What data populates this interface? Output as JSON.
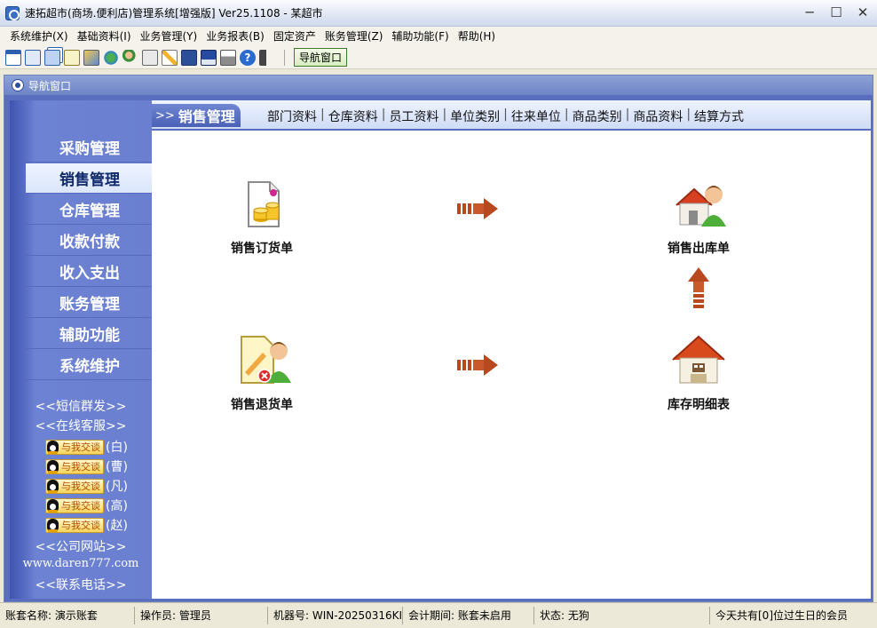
{
  "window": {
    "title": "速拓超市(商场.便利店)管理系统[增强版] Ver25.1108 - 某超市",
    "controls": [
      "─",
      "☐",
      "✕"
    ]
  },
  "menu": [
    "系统维护(X)",
    "基础资料(I)",
    "业务管理(Y)",
    "业务报表(B)",
    "固定资产",
    "账务管理(Z)",
    "辅助功能(F)",
    "帮助(H)"
  ],
  "toolbar": {
    "icons": [
      "grid-icon",
      "form-icon",
      "windows-icon",
      "message-icon",
      "report-icon",
      "refresh-icon",
      "users-icon",
      "print-preview-icon",
      "edit-icon",
      "calculator-icon",
      "save-icon",
      "printer-icon",
      "help-icon",
      "exit-icon"
    ],
    "nav_button": "导航窗口"
  },
  "nav_window": {
    "title": "导航窗口"
  },
  "sidebar": {
    "items": [
      "采购管理",
      "销售管理",
      "仓库管理",
      "收款付款",
      "收入支出",
      "账务管理",
      "辅助功能",
      "系统维护"
    ],
    "active_index": 1,
    "sms": "<<短信群发>>",
    "online_service": "<<在线客服>>",
    "qq_label": "与我交谈",
    "qq_contacts": [
      "(白)",
      "(曹)",
      "(凡)",
      "(高)",
      "(赵)"
    ],
    "company_site": "<<公司网站>>",
    "url": "www.daren777.com",
    "phone": "<<联系电话>>"
  },
  "content": {
    "prefix": ">>",
    "section": "销售管理",
    "links": [
      "部门资料",
      "仓库资料",
      "员工资料",
      "单位类别",
      "往来单位",
      "商品类别",
      "商品资料",
      "结算方式"
    ],
    "link_separator": "|",
    "flow": {
      "sales_order": "销售订货单",
      "sales_out": "销售出库单",
      "sales_return": "销售退货单",
      "inventory_detail": "库存明细表"
    }
  },
  "status": {
    "account": "账套名称: 演示账套",
    "operator": "操作员: 管理员",
    "machine": "机器号: WIN-20250316KI",
    "period": "会计期间: 账套未启用",
    "state": "状态: 无狗",
    "birthday": "今天共有[0]位过生日的会员"
  },
  "colors": {
    "sidebar": "#6a7fd0",
    "header_gradient": "#cfdcf6",
    "arrow": "#b8491e"
  }
}
